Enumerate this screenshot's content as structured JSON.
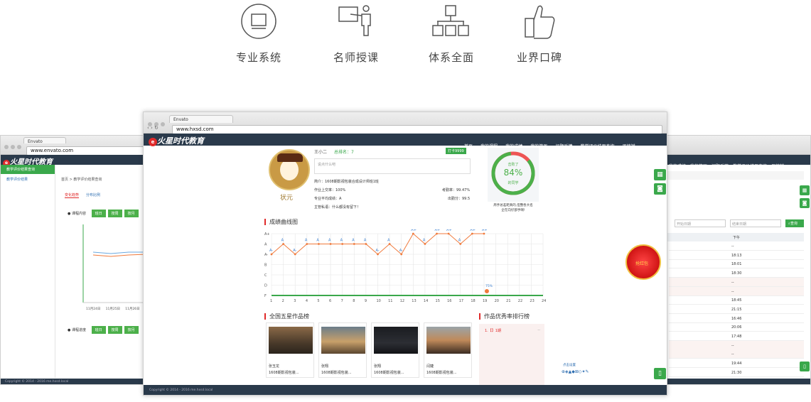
{
  "features": [
    {
      "icon": "monitor-icon",
      "label": "专业系统"
    },
    {
      "icon": "teacher-icon",
      "label": "名师授课"
    },
    {
      "icon": "org-chart-icon",
      "label": "体系全面"
    },
    {
      "icon": "thumbs-up-icon",
      "label": "业界口碑"
    }
  ],
  "main": {
    "tab": "Envato",
    "url": "www.hxsd.com",
    "logo": "火星时代教育",
    "nav": [
      "首页",
      "我的课程",
      "我的成绩",
      "我的简历",
      "问题反馈",
      "教学评价结果查询",
      "周楠斌"
    ],
    "profile": {
      "name": "王小二",
      "rank": "总排名：7",
      "badge": "打卡9999",
      "input_placeholder": "说点什么吧",
      "intro": "简介：1608期影视包装合成设计师班1班",
      "homework": "作业上交率：100%",
      "attendance": "考勤率：99.47%",
      "avg": "专业平均成绩：A",
      "score": "出勤分：99.5",
      "teacher": "主管私语：什么都没有留下！",
      "avatar_label": "状元"
    },
    "circle": {
      "top": "击败了",
      "pct": "84%",
      "bottom": "的同学",
      "caption1": "周手总差距真的,但整各大名",
      "caption2": "企在向仔部手啊!"
    },
    "chart_title": "成绩曲线图",
    "section_works": "全国五星作品榜",
    "section_rank": "作品优秀率排行榜",
    "rank_item": "1.【】1期",
    "rank_dash": "--",
    "works": [
      {
        "name": "张玉龙",
        "desc": "1608期影视包装..."
      },
      {
        "name": "张翔",
        "desc": "1608期影视包装..."
      },
      {
        "name": "张翔",
        "desc": "1608期影视包装..."
      },
      {
        "name": "闫婕",
        "desc": "1608期影视包装..."
      }
    ],
    "footer": "Copyright © 2014 - 2016 me.hxsd.local",
    "red_packet": "抢红包",
    "tool_label": "点击设置"
  },
  "left": {
    "tab": "Envato",
    "url": "www.envato.com",
    "logo": "火星时代教育",
    "sidebar_active": "教学评价结果查询",
    "sidebar_item": "教学评价结果",
    "breadcrumb": "首页 > 教学评价结果查询",
    "tabs": [
      "变化趋势",
      "分布比例"
    ],
    "row1_label": "课程内容",
    "row2_label": "课程进度",
    "buttons": [
      "班日",
      "按周",
      "按月"
    ],
    "xticks": [
      "11月24日",
      "11月25日",
      "11月26日"
    ],
    "footer": "Copyright © 2014 - 2016 me.hxsd.local"
  },
  "right": {
    "nav": [
      "我的成绩",
      "我的简历",
      "问题反馈",
      "教学评价结果查询",
      "周楠斌"
    ],
    "start_placeholder": "开始日期",
    "end_placeholder": "结束日期",
    "query": "查询",
    "col_header": "下午",
    "times": [
      "--",
      "18:13",
      "18:01",
      "18:30",
      "--",
      "--",
      "18:45",
      "21:15",
      "16:46",
      "20:06",
      "17:48",
      "--",
      "--",
      "19:44",
      "21:30"
    ]
  },
  "chart_data": {
    "type": "line",
    "title": "成绩曲线图",
    "x": [
      1,
      2,
      3,
      4,
      5,
      6,
      7,
      8,
      9,
      10,
      11,
      12,
      13,
      14,
      15,
      16,
      17,
      18,
      19,
      20,
      21,
      22,
      23,
      24
    ],
    "y_categories": [
      "A+",
      "A",
      "A-",
      "B",
      "C",
      "D",
      "F"
    ],
    "series": [
      {
        "values": [
          "A-",
          "A",
          "A-",
          "A",
          "A",
          "A",
          "A",
          "A",
          "A",
          "A-",
          "A",
          "A-",
          "A+",
          "A",
          "A+",
          "A+",
          "A",
          "A+",
          "A+"
        ],
        "point_labels": [
          "A-",
          "A",
          "A-",
          "A",
          "A",
          "A",
          "A",
          "A",
          "A",
          "A-",
          "A",
          "A-",
          "A+",
          "A",
          "A+",
          "A+",
          "A",
          "A+",
          "A+"
        ]
      }
    ],
    "marker_label": "75%",
    "colors": {
      "line": "#f07a3c",
      "base": "#3aa84b",
      "grid": "#e6e6e6"
    }
  }
}
